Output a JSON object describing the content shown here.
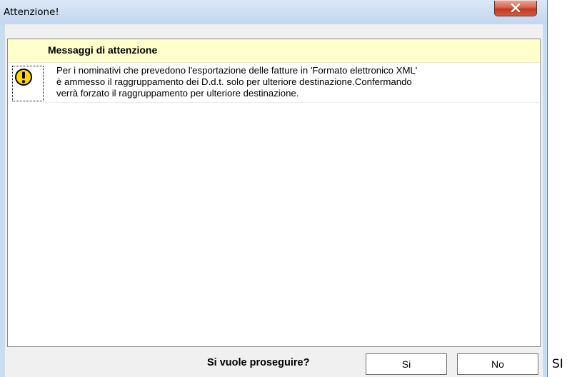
{
  "window": {
    "title": "Attenzione!",
    "close_symbol": "X"
  },
  "panel": {
    "header": "Messaggi di attenzione",
    "messages": [
      {
        "icon": "exclamation-warning-icon",
        "lines": [
          "Per i nominativi che prevedono l'esportazione delle fatture in 'Formato elettronico XML'",
          "è ammesso il raggruppamento dei D.d.t. solo per ulteriore destinazione.Confermando",
          "verrà forzato il raggruppamento per ulteriore destinazione."
        ]
      }
    ]
  },
  "footer": {
    "question": "Si vuole proseguire?",
    "yes_label": "Si",
    "no_label": "No"
  },
  "outside_text": "SI",
  "colors": {
    "header_background": "#ffffcc",
    "warning_icon": "#ffd800",
    "close_button": "#c9452b",
    "window_frame": "#c9dcf0"
  }
}
